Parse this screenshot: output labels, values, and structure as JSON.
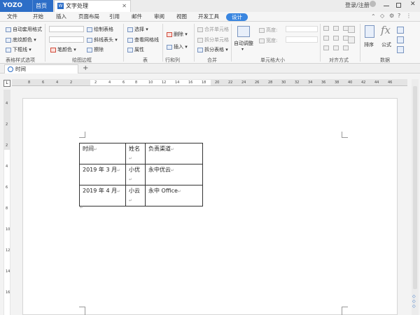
{
  "titlebar": {
    "logo": "YOZO",
    "home_tab": "首页",
    "doc_tab": "文字处理",
    "login": "登录/注册",
    "doc_icon": "W",
    "close_glyph": "✕"
  },
  "menubar": {
    "items": [
      "文件",
      "开始",
      "插入",
      "页面布局",
      "引用",
      "邮件",
      "审阅",
      "视图",
      "开发工具",
      "设计"
    ],
    "active": "设计"
  },
  "ribbon": {
    "table_style": {
      "auto_format": "自动套用格式",
      "shading": "底纹颜色",
      "bottom_border": "下框线",
      "group_label": "表格样式选项"
    },
    "draw_border": {
      "draw_table": "绘制表格",
      "diagonal_header": "斜线表头",
      "pen_color": "笔颜色",
      "eraser": "擦除",
      "group_label": "绘图边框"
    },
    "table": {
      "select": "选择",
      "view_gridlines": "查看网格线",
      "properties": "属性",
      "group_label": "表"
    },
    "rows_cols": {
      "delete": "删除",
      "insert": "插入",
      "group_label": "行和列"
    },
    "merge": {
      "merge_cells": "合并单元格",
      "split_cells": "拆分单元格",
      "split_table": "拆分表格",
      "group_label": "合并"
    },
    "cell_size": {
      "auto_fit": "自动调整",
      "height": "高度:",
      "width": "宽度:",
      "group_label": "单元格大小"
    },
    "alignment": {
      "group_label": "对齐方式"
    },
    "data": {
      "sort": "排序",
      "formula": "公式",
      "formula_glyph": "fx",
      "group_label": "数据"
    }
  },
  "doc_tabs": {
    "current": "时间",
    "add": "+"
  },
  "ruler": {
    "h_left": [
      "8",
      "6",
      "4",
      "2"
    ],
    "h_mid": [
      "2",
      "4",
      "6"
    ],
    "h_after": [
      "8",
      "10",
      "12",
      "14",
      "16",
      "18",
      "20",
      "22",
      "24",
      "26",
      "28",
      "30",
      "32",
      "34",
      "36",
      "38",
      "40",
      "42",
      "44",
      "46"
    ],
    "v": [
      "4",
      "2",
      "2",
      "4",
      "6",
      "8",
      "10",
      "12",
      "14",
      "16"
    ]
  },
  "document": {
    "table": {
      "headers": [
        "时间",
        "姓名",
        "负责渠道"
      ],
      "rows": [
        [
          "2019 年 3 月",
          "小优",
          "永中优云"
        ],
        [
          "2019 年 4 月",
          "小云",
          "永中 Office"
        ]
      ],
      "cell_mark": "↵"
    },
    "para_mark": "↵"
  }
}
